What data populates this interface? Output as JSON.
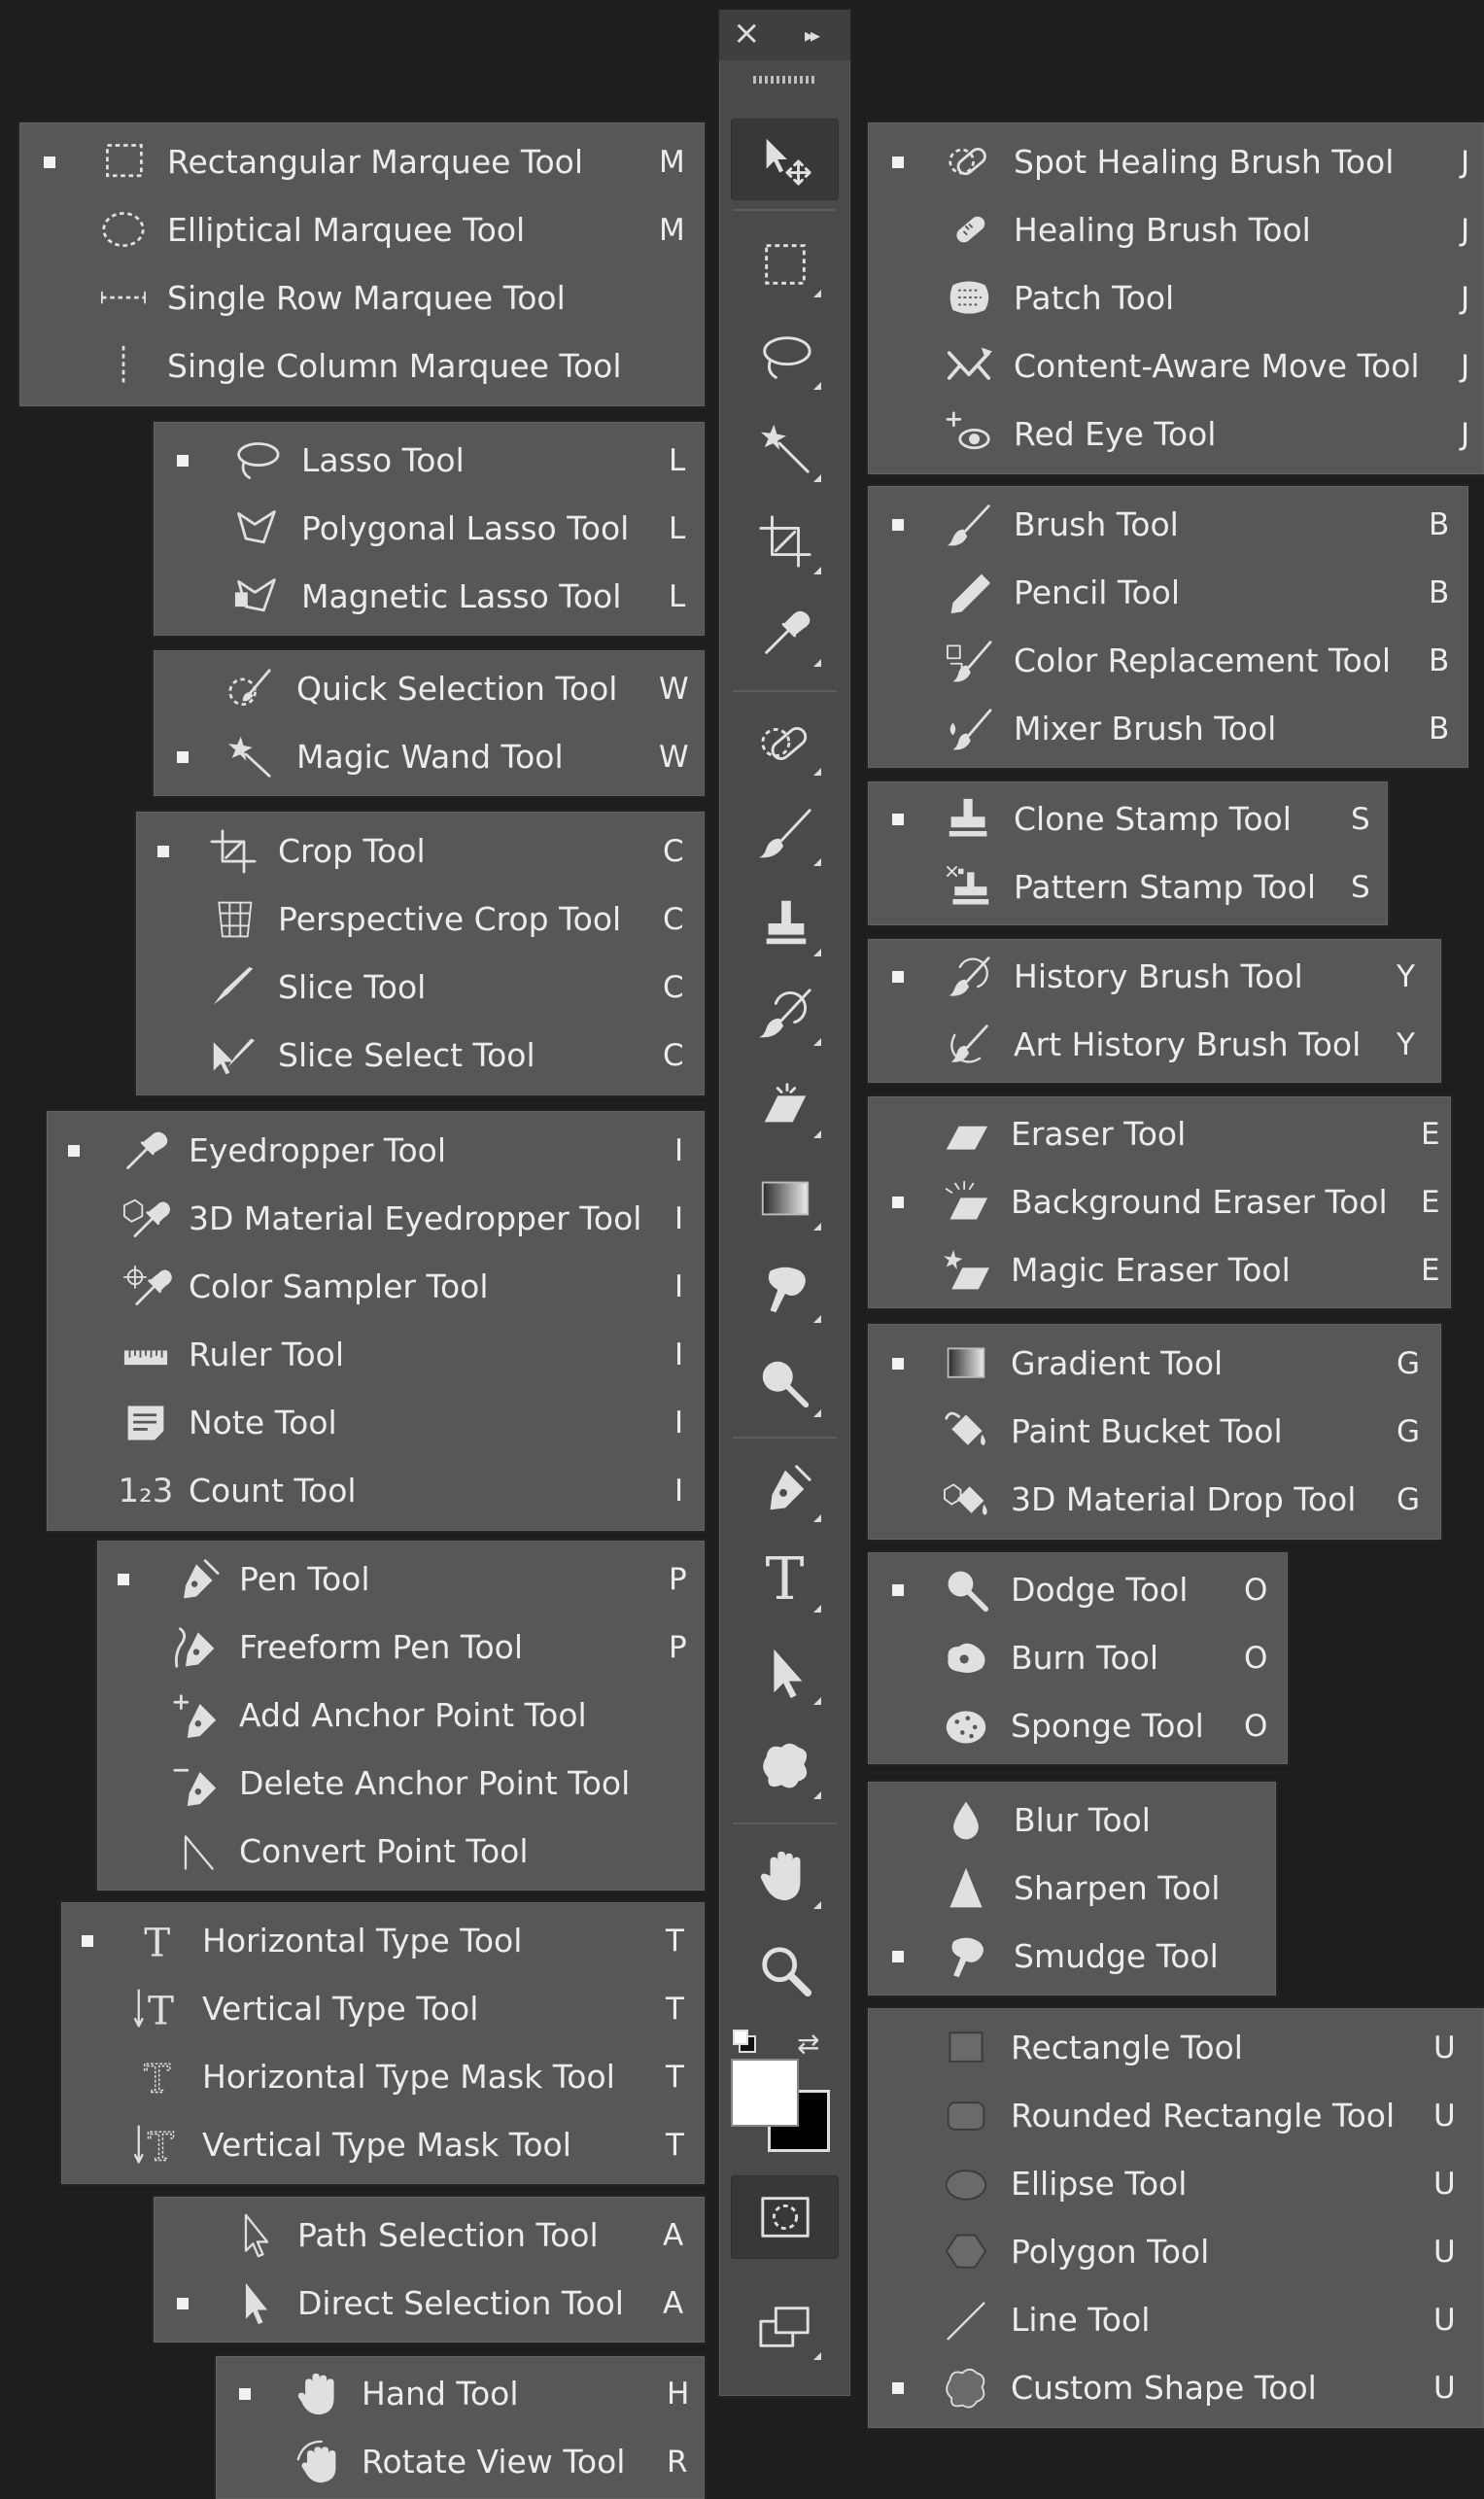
{
  "toolbar": {
    "close_glyph": "×",
    "collapse_glyph": "▸▸",
    "tools": [
      {
        "icon": "move-icon"
      },
      {
        "icon": "marquee-icon"
      },
      {
        "icon": "lasso-icon"
      },
      {
        "icon": "magic-wand-icon"
      },
      {
        "icon": "crop-icon"
      },
      {
        "icon": "eyedropper-icon"
      },
      {
        "icon": "spot-healing-icon"
      },
      {
        "icon": "brush-icon"
      },
      {
        "icon": "clone-stamp-icon"
      },
      {
        "icon": "history-brush-icon"
      },
      {
        "icon": "eraser-icon"
      },
      {
        "icon": "gradient-icon"
      },
      {
        "icon": "smudge-icon"
      },
      {
        "icon": "dodge-icon"
      },
      {
        "icon": "pen-icon"
      },
      {
        "icon": "type-icon"
      },
      {
        "icon": "path-selection-icon"
      },
      {
        "icon": "custom-shape-icon"
      },
      {
        "icon": "hand-icon"
      },
      {
        "icon": "zoom-icon"
      }
    ],
    "type_glyph": "T",
    "foreground_color": "#ffffff",
    "background_color": "#000000"
  },
  "left_groups": {
    "marquee": [
      {
        "label": "Rectangular Marquee Tool",
        "key": "M",
        "selected": true
      },
      {
        "label": "Elliptical Marquee Tool",
        "key": "M"
      },
      {
        "label": "Single Row Marquee Tool",
        "key": ""
      },
      {
        "label": "Single Column Marquee Tool",
        "key": ""
      }
    ],
    "lasso": [
      {
        "label": "Lasso Tool",
        "key": "L",
        "selected": true
      },
      {
        "label": "Polygonal Lasso Tool",
        "key": "L"
      },
      {
        "label": "Magnetic Lasso Tool",
        "key": "L"
      }
    ],
    "selection": [
      {
        "label": "Quick Selection Tool",
        "key": "W"
      },
      {
        "label": "Magic Wand Tool",
        "key": "W",
        "selected": true
      }
    ],
    "crop": [
      {
        "label": "Crop Tool",
        "key": "C",
        "selected": true
      },
      {
        "label": "Perspective Crop Tool",
        "key": "C"
      },
      {
        "label": "Slice Tool",
        "key": "C"
      },
      {
        "label": "Slice Select Tool",
        "key": "C"
      }
    ],
    "eyedropper": [
      {
        "label": "Eyedropper Tool",
        "key": "I",
        "selected": true
      },
      {
        "label": "3D Material Eyedropper Tool",
        "key": "I"
      },
      {
        "label": "Color Sampler Tool",
        "key": "I"
      },
      {
        "label": "Ruler Tool",
        "key": "I"
      },
      {
        "label": "Note Tool",
        "key": "I"
      },
      {
        "label": "Count Tool",
        "key": "I",
        "icon_text": "1₂3"
      }
    ],
    "pen": [
      {
        "label": "Pen Tool",
        "key": "P",
        "selected": true
      },
      {
        "label": "Freeform Pen Tool",
        "key": "P"
      },
      {
        "label": "Add Anchor Point Tool",
        "key": ""
      },
      {
        "label": "Delete Anchor Point Tool",
        "key": ""
      },
      {
        "label": "Convert Point Tool",
        "key": ""
      }
    ],
    "type": [
      {
        "label": "Horizontal Type Tool",
        "key": "T",
        "selected": true
      },
      {
        "label": "Vertical Type Tool",
        "key": "T"
      },
      {
        "label": "Horizontal Type Mask Tool",
        "key": "T"
      },
      {
        "label": "Vertical Type Mask Tool",
        "key": "T"
      }
    ],
    "path": [
      {
        "label": "Path Selection Tool",
        "key": "A"
      },
      {
        "label": "Direct Selection Tool",
        "key": "A",
        "selected": true
      }
    ],
    "hand": [
      {
        "label": "Hand Tool",
        "key": "H",
        "selected": true
      },
      {
        "label": "Rotate View Tool",
        "key": "R"
      }
    ]
  },
  "right_groups": {
    "healing": [
      {
        "label": "Spot Healing Brush Tool",
        "key": "J",
        "selected": true
      },
      {
        "label": "Healing Brush Tool",
        "key": "J"
      },
      {
        "label": "Patch Tool",
        "key": "J"
      },
      {
        "label": "Content-Aware Move Tool",
        "key": "J"
      },
      {
        "label": "Red Eye Tool",
        "key": "J"
      }
    ],
    "brush": [
      {
        "label": "Brush Tool",
        "key": "B",
        "selected": true
      },
      {
        "label": "Pencil Tool",
        "key": "B"
      },
      {
        "label": "Color Replacement Tool",
        "key": "B"
      },
      {
        "label": "Mixer Brush Tool",
        "key": "B"
      }
    ],
    "stamp": [
      {
        "label": "Clone Stamp Tool",
        "key": "S",
        "selected": true
      },
      {
        "label": "Pattern Stamp Tool",
        "key": "S"
      }
    ],
    "history": [
      {
        "label": "History Brush Tool",
        "key": "Y",
        "selected": true
      },
      {
        "label": "Art History Brush Tool",
        "key": "Y"
      }
    ],
    "eraser": [
      {
        "label": "Eraser Tool",
        "key": "E"
      },
      {
        "label": "Background Eraser Tool",
        "key": "E",
        "selected": true
      },
      {
        "label": "Magic Eraser Tool",
        "key": "E"
      }
    ],
    "gradient": [
      {
        "label": "Gradient Tool",
        "key": "G",
        "selected": true
      },
      {
        "label": "Paint Bucket Tool",
        "key": "G"
      },
      {
        "label": "3D Material Drop Tool",
        "key": "G"
      }
    ],
    "dodge": [
      {
        "label": "Dodge Tool",
        "key": "O",
        "selected": true
      },
      {
        "label": "Burn Tool",
        "key": "O"
      },
      {
        "label": "Sponge Tool",
        "key": "O"
      }
    ],
    "blur": [
      {
        "label": "Blur Tool",
        "key": ""
      },
      {
        "label": "Sharpen Tool",
        "key": ""
      },
      {
        "label": "Smudge Tool",
        "key": "",
        "selected": true
      }
    ],
    "shape": [
      {
        "label": "Rectangle Tool",
        "key": "U"
      },
      {
        "label": "Rounded Rectangle Tool",
        "key": "U"
      },
      {
        "label": "Ellipse Tool",
        "key": "U"
      },
      {
        "label": "Polygon Tool",
        "key": "U"
      },
      {
        "label": "Line Tool",
        "key": "U"
      },
      {
        "label": "Custom Shape Tool",
        "key": "U",
        "selected": true
      }
    ]
  }
}
